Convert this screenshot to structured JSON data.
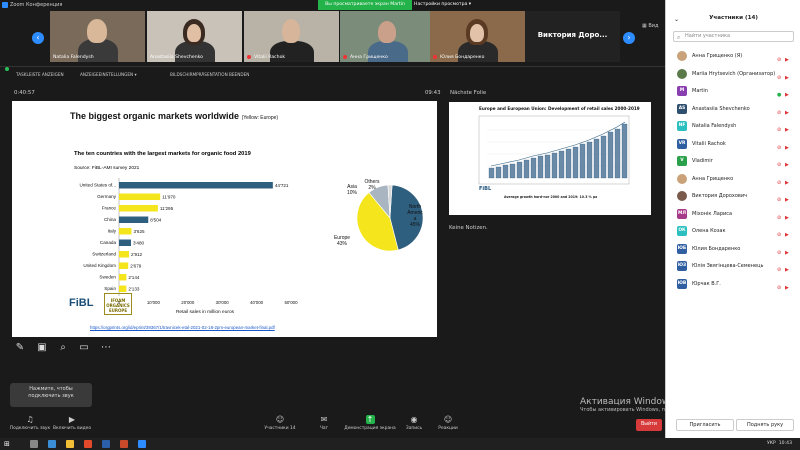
{
  "titlebar": {
    "title": "Zoom Конференция",
    "viewing_banner": "Вы просматриваете экран Martin",
    "view_options": "Настройки просмотра"
  },
  "gallery": {
    "tiles": [
      {
        "name": "Natalia Falendysh"
      },
      {
        "name": "Anastasiia Shevchenko"
      },
      {
        "name": "Vitalii Rachok"
      },
      {
        "name": "Анна Грищенко"
      },
      {
        "name": "Юлия Бондаренко"
      }
    ],
    "name_tile": "Виктория  Доро...",
    "layout_label": "Вид"
  },
  "sharebar": {
    "item1": "TASKLEISTE ANZEIGEN",
    "item2": "ANZEIGEEINSTELLUNGEN ▾",
    "item3": "BILDSCHIRMPRÄSENTATION BEENDEN"
  },
  "presenter": {
    "timer": "0:40:57",
    "clock": "09:43",
    "next_label": "Nächste Folie",
    "notes": "Keine Notizen."
  },
  "slide": {
    "title": "The biggest organic markets worldwide",
    "title_note": "(Yellow: Europe)",
    "chart_title": "The ten countries with the largest markets for organic food 2019",
    "chart_source": "Source: FiBL-AMI survey 2021",
    "url": "https://orgprints.org/id/eprint/39367/1/travnicek-etal-2021-02-18-2pm-european-market-final.pdf",
    "fibl_logo": "FiBL",
    "ifoam_logo": "IFOAM ORGANICS EUROPE"
  },
  "chart_data": [
    {
      "type": "bar",
      "orientation": "horizontal",
      "title": "The ten countries with the largest markets for organic food 2019",
      "xlabel": "Retail sales in million euros",
      "xlim": [
        0,
        50000
      ],
      "xticks": [
        "0",
        "10'000",
        "20'000",
        "30'000",
        "40'000",
        "50'000"
      ],
      "categories": [
        "United States of...",
        "Germany",
        "France",
        "China",
        "Italy",
        "Canada",
        "Switzerland",
        "United Kingdom",
        "Sweden",
        "Spain"
      ],
      "values": [
        44721,
        11970,
        11295,
        8504,
        3625,
        3480,
        2912,
        2679,
        2144,
        2133
      ],
      "labels": [
        "44'721",
        "11'970",
        "11'295",
        "8'504",
        "3'625",
        "3'480",
        "2'912",
        "2'679",
        "2'144",
        "2'133"
      ],
      "colors": [
        "#2f5f7f",
        "#f5e51c",
        "#f5e51c",
        "#2f5f7f",
        "#f5e51c",
        "#2f5f7f",
        "#f5e51c",
        "#f5e51c",
        "#f5e51c",
        "#f5e51c"
      ]
    },
    {
      "type": "pie",
      "slices": [
        {
          "label": "North America",
          "value": 45,
          "display": [
            "North",
            "Americ",
            "a",
            "45%"
          ],
          "color": "#2f5f7f"
        },
        {
          "label": "Europe",
          "value": 43,
          "display": [
            "Europe",
            "43%"
          ],
          "color": "#f5e51c"
        },
        {
          "label": "Asia",
          "value": 10,
          "display": [
            "Asia",
            "10%"
          ],
          "color": "#a9b6c2"
        },
        {
          "label": "Others",
          "value": 2,
          "display": [
            "Others",
            "2%"
          ],
          "color": "#d9d9d9"
        }
      ]
    }
  ],
  "next_slide": {
    "title": "Europe and European Union: Development of retail sales  2000-2019",
    "legend": "Average growth hard-nor 2000 and 2019:  10.3 % pa",
    "fibl": "FiBL"
  },
  "tools": {
    "pen": "pen-icon",
    "laser": "laser-icon",
    "zoom": "zoom-icon",
    "screen": "screen-icon",
    "more": "more-icon"
  },
  "audio_popup": {
    "line1": "Нажмите, чтобы",
    "line2": "подключить звук"
  },
  "toolbar": {
    "audio": "Подключить звук",
    "video": "Включить видео",
    "participants": "Участники",
    "participants_count": "14",
    "chat": "Чат",
    "share": "Демонстрация экрана",
    "record": "Запись",
    "reactions": "Реакции",
    "leave": "Выйти"
  },
  "watermark": {
    "line1": "Активация Windows",
    "line2": "Чтобы активировать Windows, перейдите в раздел \"Параметры\"."
  },
  "panel": {
    "title": "Участники (14)",
    "search_placeholder": "Найти участника",
    "participants": [
      {
        "initials": "",
        "name": "Анна Грищенко (Я)",
        "color": "#c9a27a",
        "photo": true
      },
      {
        "initials": "",
        "name": "Mariia Hrytsevich (Организатор)",
        "color": "#5a7a4a",
        "photo": true
      },
      {
        "initials": "M",
        "name": "Martin",
        "color": "#8a3fb0",
        "photo": false,
        "active": true
      },
      {
        "initials": "AS",
        "name": "Anastasiia Shevchenko",
        "color": "#2f4f6f",
        "photo": false
      },
      {
        "initials": "NF",
        "name": "Natalia Falendysh",
        "color": "#2bbfbf",
        "photo": false
      },
      {
        "initials": "VR",
        "name": "Vitalii Rachok",
        "color": "#2f5fa0",
        "photo": false
      },
      {
        "initials": "V",
        "name": "Vladimir",
        "color": "#2ba04a",
        "photo": false
      },
      {
        "initials": "",
        "name": "Анна Грищенко",
        "color": "#c9a27a",
        "photo": true
      },
      {
        "initials": "",
        "name": "Виктория Дорохович",
        "color": "#7a5a4a",
        "photo": true
      },
      {
        "initials": "МЛ",
        "name": "Міхонік Лариса",
        "color": "#a83a8a",
        "photo": false
      },
      {
        "initials": "ОК",
        "name": "Олена Козак",
        "color": "#2bbfbf",
        "photo": false
      },
      {
        "initials": "ЮБ",
        "name": "Юлия Бондаренко",
        "color": "#2f5fa0",
        "photo": false
      },
      {
        "initials": "ЮЗ",
        "name": "Юлія Звягінцева-Семенець",
        "color": "#2f5fa0",
        "photo": false
      },
      {
        "initials": "ЮВ",
        "name": "Юрчак В.Г.",
        "color": "#2f5fa0",
        "photo": false
      }
    ],
    "invite": "Пригласить",
    "raise_hand": "Поднять руку"
  },
  "taskbar": {
    "lang": "УКР",
    "time": "10:43"
  }
}
